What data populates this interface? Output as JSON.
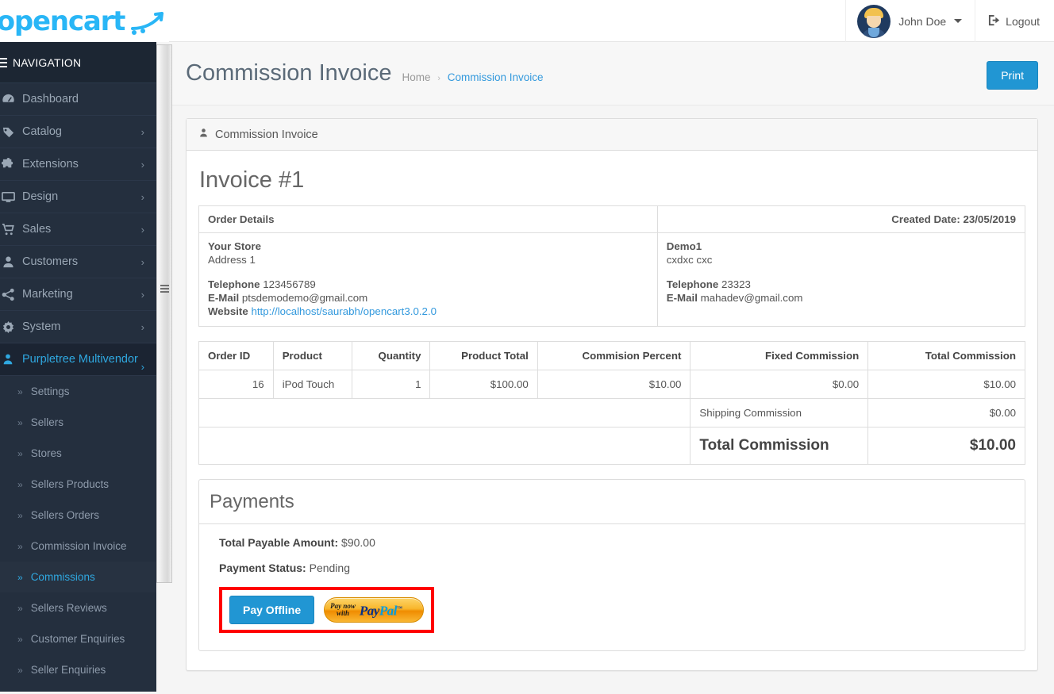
{
  "brand": {
    "name": "opencart",
    "logo_color": "#29b6f6"
  },
  "topbar": {
    "username": "John Doe",
    "logout_label": "Logout"
  },
  "sidebar": {
    "nav_header": "NAVIGATION",
    "items": [
      {
        "label": "Dashboard",
        "icon": "dashboard-icon",
        "has_children": false
      },
      {
        "label": "Catalog",
        "icon": "tag-icon",
        "has_children": true
      },
      {
        "label": "Extensions",
        "icon": "puzzle-icon",
        "has_children": true
      },
      {
        "label": "Design",
        "icon": "desktop-icon",
        "has_children": true
      },
      {
        "label": "Sales",
        "icon": "cart-icon",
        "has_children": true
      },
      {
        "label": "Customers",
        "icon": "user-icon",
        "has_children": true
      },
      {
        "label": "Marketing",
        "icon": "share-icon",
        "has_children": true
      },
      {
        "label": "System",
        "icon": "gear-icon",
        "has_children": true
      },
      {
        "label": "Purpletree Multivendor",
        "icon": "vendor-user-icon",
        "has_children": true,
        "active": true
      }
    ],
    "subitems": [
      {
        "label": "Settings"
      },
      {
        "label": "Sellers"
      },
      {
        "label": "Stores"
      },
      {
        "label": "Sellers Products"
      },
      {
        "label": "Sellers Orders"
      },
      {
        "label": "Commission Invoice"
      },
      {
        "label": "Commissions",
        "active": true
      },
      {
        "label": "Sellers Reviews"
      },
      {
        "label": "Customer Enquiries"
      },
      {
        "label": "Seller Enquiries"
      }
    ]
  },
  "page": {
    "title": "Commission Invoice",
    "breadcrumb": {
      "home": "Home",
      "separator": "›",
      "current": "Commission Invoice"
    },
    "print_label": "Print"
  },
  "panel": {
    "heading": "Commission Invoice",
    "invoice_number": "Invoice #1"
  },
  "invoice": {
    "order_details_label": "Order Details",
    "created_date_label": "Created Date: 23/05/2019",
    "store": {
      "name": "Your Store",
      "address": "Address 1",
      "telephone_label": "Telephone",
      "telephone": "123456789",
      "email_label": "E-Mail",
      "email": "ptsdemodemo@gmail.com",
      "website_label": "Website",
      "website": "http://localhost/saurabh/opencart3.0.2.0"
    },
    "seller": {
      "name": "Demo1",
      "address": "cxdxc cxc",
      "telephone_label": "Telephone",
      "telephone": "23323",
      "email_label": "E-Mail",
      "email": "mahadev@gmail.com"
    }
  },
  "commission_table": {
    "columns": [
      "Order ID",
      "Product",
      "Quantity",
      "Product Total",
      "Commision Percent",
      "Fixed Commission",
      "Total Commission"
    ],
    "rows": [
      {
        "order_id": "16",
        "product": "iPod Touch",
        "quantity": "1",
        "product_total": "$100.00",
        "commision_percent": "$10.00",
        "fixed_commission": "$0.00",
        "total_commission": "$10.00"
      }
    ],
    "shipping_label": "Shipping Commission",
    "shipping_value": "$0.00",
    "total_label": "Total Commission",
    "total_value": "$10.00"
  },
  "payments": {
    "heading": "Payments",
    "total_payable_label": "Total Payable Amount",
    "total_payable_value": "$90.00",
    "payment_status_label": "Payment Status",
    "payment_status_value": "Pending",
    "pay_offline_label": "Pay Offline",
    "paypal": {
      "pre_line1": "Pay now",
      "pre_line2": "with",
      "logo_pay": "Pay",
      "logo_pal": "Pal",
      "tm": "™"
    },
    "highlight_color": "#ff0000"
  }
}
